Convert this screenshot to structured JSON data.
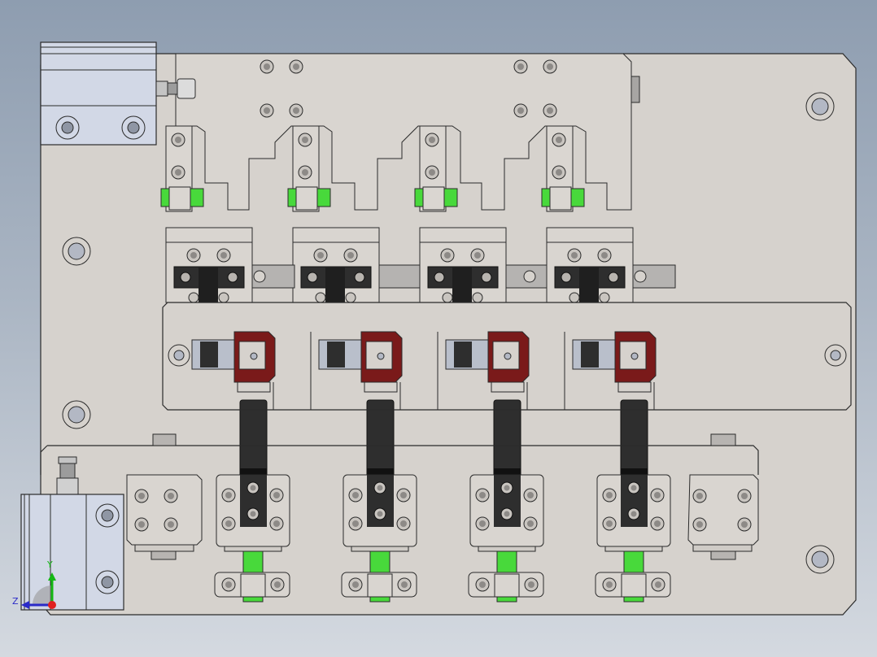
{
  "viewport": {
    "background_top": "#8e9db0",
    "background_bottom": "#d4d9e0"
  },
  "colors": {
    "plate": "#d6d2cd",
    "edge": "#2b2b2b",
    "rail": "#b5b3b1",
    "block": "#2e2e2e",
    "gripper": "#7a1a1a",
    "pin": "#48d93b",
    "slider": "#d2d8e6"
  },
  "fixture": {
    "station_count": 4,
    "parts": [
      "base-plate",
      "clamp-arm",
      "linear-rail",
      "jaw-carrier",
      "gripper-jaw",
      "pusher-rod",
      "cylinder-mount",
      "guide-pin",
      "air-cylinder",
      "air-fitting",
      "pneumatic-slider"
    ]
  },
  "triad": {
    "y_label": "Y",
    "z_label": "Z",
    "x_axis_color": "#e02020",
    "y_axis_color": "#14b814",
    "z_axis_color": "#2a2ac8"
  }
}
